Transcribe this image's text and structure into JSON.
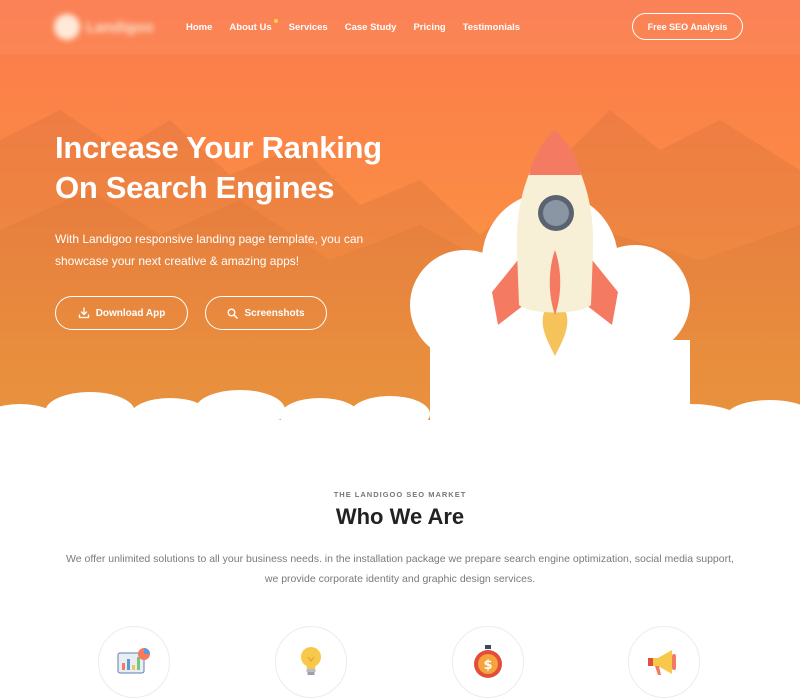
{
  "brand": {
    "name": "Landigoo"
  },
  "nav": {
    "items": [
      {
        "label": "Home"
      },
      {
        "label": "About Us"
      },
      {
        "label": "Services"
      },
      {
        "label": "Case Study"
      },
      {
        "label": "Pricing"
      },
      {
        "label": "Testimonials"
      }
    ],
    "cta_label": "Free SEO Analysis"
  },
  "hero": {
    "title_line1": "Increase Your Ranking",
    "title_line2": "On Search Engines",
    "subtitle": "With Landigoo responsive landing page template, you can showcase your next creative & amazing apps!",
    "download_label": "Download App",
    "screenshots_label": "Screenshots"
  },
  "about": {
    "eyebrow": "THE LANDIGOO SEO MARKET",
    "title": "Who We Are",
    "description": "We offer unlimited solutions to all your business needs. in the installation package we prepare search engine optimization, social media support, we provide corporate identity and graphic design services."
  },
  "features": [
    {
      "icon": "analytics-chart-icon"
    },
    {
      "icon": "lightbulb-icon"
    },
    {
      "icon": "money-stopwatch-icon"
    },
    {
      "icon": "megaphone-icon"
    }
  ],
  "colors": {
    "accent": "#fb7a4c",
    "accent_light": "#fca344",
    "rocket_body": "#f7f0d6",
    "rocket_red": "#f47b62",
    "flame": "#f5c35a"
  }
}
